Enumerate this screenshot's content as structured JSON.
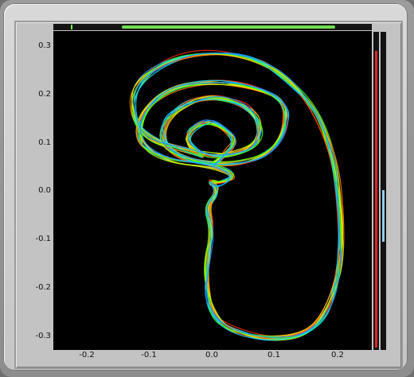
{
  "chart_data": {
    "type": "line",
    "title": "",
    "xlabel": "",
    "ylabel": "",
    "xlim": [
      -0.28,
      0.24
    ],
    "ylim": [
      -0.32,
      0.32
    ],
    "xticks": [
      "-0.2",
      "-0.1",
      "0.0",
      "0.1",
      "0.2"
    ],
    "yticks": [
      "0.3",
      "0.2",
      "0.1",
      "0.0",
      "-0.1",
      "-0.2",
      "-0.3"
    ],
    "series_colors": [
      "#ff2a00",
      "#ff7a00",
      "#ffd000",
      "#b8ff00",
      "#3cff00",
      "#00e0ff",
      "#1e90ff"
    ],
    "trace_count": 14,
    "base_path": [
      [
        -0.02,
        0.05
      ],
      [
        0.0,
        0.07
      ],
      [
        0.02,
        0.1
      ],
      [
        0.0,
        0.13
      ],
      [
        -0.03,
        0.14
      ],
      [
        -0.06,
        0.12
      ],
      [
        -0.06,
        0.09
      ],
      [
        -0.03,
        0.07
      ],
      [
        0.01,
        0.07
      ],
      [
        0.05,
        0.09
      ],
      [
        0.06,
        0.13
      ],
      [
        0.04,
        0.17
      ],
      [
        -0.01,
        0.19
      ],
      [
        -0.06,
        0.18
      ],
      [
        -0.1,
        0.14
      ],
      [
        -0.1,
        0.09
      ],
      [
        -0.06,
        0.06
      ],
      [
        0.01,
        0.05
      ],
      [
        0.07,
        0.07
      ],
      [
        0.1,
        0.12
      ],
      [
        0.1,
        0.18
      ],
      [
        0.05,
        0.21
      ],
      [
        -0.03,
        0.22
      ],
      [
        -0.1,
        0.2
      ],
      [
        -0.14,
        0.15
      ],
      [
        -0.14,
        0.09
      ],
      [
        -0.09,
        0.06
      ],
      [
        -0.02,
        0.05
      ],
      [
        0.02,
        0.03
      ],
      [
        -0.01,
        0.01
      ],
      [
        -0.03,
        0.02
      ],
      [
        -0.01,
        0.0
      ],
      [
        -0.03,
        -0.03
      ],
      [
        -0.02,
        -0.08
      ],
      [
        -0.03,
        -0.14
      ],
      [
        -0.03,
        -0.2
      ],
      [
        -0.02,
        -0.25
      ],
      [
        0.01,
        -0.28
      ],
      [
        0.07,
        -0.3
      ],
      [
        0.13,
        -0.29
      ],
      [
        0.17,
        -0.24
      ],
      [
        0.19,
        -0.15
      ],
      [
        0.19,
        -0.05
      ],
      [
        0.18,
        0.06
      ],
      [
        0.15,
        0.16
      ],
      [
        0.1,
        0.23
      ],
      [
        0.04,
        0.27
      ],
      [
        -0.03,
        0.28
      ],
      [
        -0.1,
        0.26
      ],
      [
        -0.15,
        0.21
      ],
      [
        -0.15,
        0.14
      ],
      [
        -0.12,
        0.1
      ],
      [
        -0.06,
        0.08
      ],
      [
        -0.01,
        0.06
      ]
    ]
  },
  "timeline": {
    "position": 0.05,
    "range_start": 0.215,
    "range_end": 0.885
  },
  "meters": [
    {
      "name": "left-level",
      "level": 0.93,
      "color": "#e02525"
    },
    {
      "name": "right-level",
      "level": 0.16,
      "color": "#8fd0f0"
    }
  ]
}
